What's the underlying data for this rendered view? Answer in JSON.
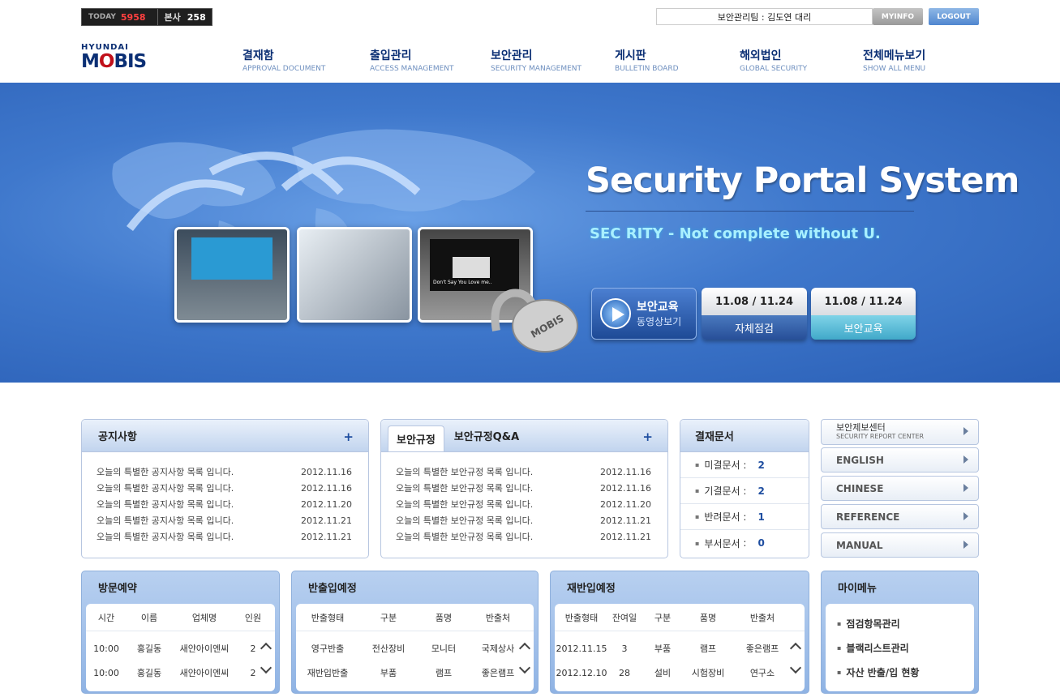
{
  "header": {
    "today_label": "TODAY",
    "today_count": "5958",
    "hq_label": "본사",
    "hq_count": "258",
    "user": "보안관리팀 : 김도연 대리",
    "myinfo": "MYINFO",
    "logout": "LOGOUT",
    "logo_small": "HYUNDAI",
    "logo_big_1": "M",
    "logo_big_2": "O",
    "logo_big_3": "BIS"
  },
  "nav": [
    {
      "ko": "결재함",
      "en": "APPROVAL DOCUMENT"
    },
    {
      "ko": "출입관리",
      "en": "ACCESS MANAGEMENT"
    },
    {
      "ko": "보안관리",
      "en": "SECURITY MANAGEMENT"
    },
    {
      "ko": "게시판",
      "en": "BULLETIN BOARD"
    },
    {
      "ko": "해외법인",
      "en": "GLOBAL SECURITY"
    },
    {
      "ko": "전체메뉴보기",
      "en": "SHOW ALL MENU"
    }
  ],
  "hero": {
    "title": "Security Portal System",
    "slogan": "SEC RITY - Not complete without U.",
    "video_1": "보안교육",
    "video_2": "동영상보기",
    "sched1_date": "11.08 / 11.24",
    "sched1_label": "자체점검",
    "sched2_date": "11.08 / 11.24",
    "sched2_label": "보안교육",
    "screen_text": "Don't Say You Love me..",
    "lock_text": "MOBIS"
  },
  "notice": {
    "title": "공지사항",
    "plus": "+",
    "rows": [
      {
        "t": "오늘의 특별한 공지사항 목록 입니다.",
        "d": "2012.11.16"
      },
      {
        "t": "오늘의 특별한 공지사항 목록 입니다.",
        "d": "2012.11.16"
      },
      {
        "t": "오늘의 특별한 공지사항 목록 입니다.",
        "d": "2012.11.20"
      },
      {
        "t": "오늘의 특별한 공지사항 목록 입니다.",
        "d": "2012.11.21"
      },
      {
        "t": "오늘의 특별한 공지사항 목록 입니다.",
        "d": "2012.11.21"
      }
    ]
  },
  "rules": {
    "tab1": "보안규정",
    "tab2": "보안규정Q&A",
    "plus": "+",
    "rows": [
      {
        "t": "오늘의 특별한 보안규정 목록 입니다.",
        "d": "2012.11.16"
      },
      {
        "t": "오늘의 특별한 보안규정 목록 입니다.",
        "d": "2012.11.16"
      },
      {
        "t": "오늘의 특별한 보안규정 목록 입니다.",
        "d": "2012.11.20"
      },
      {
        "t": "오늘의 특별한 보안규정 목록 입니다.",
        "d": "2012.11.21"
      },
      {
        "t": "오늘의 특별한 보안규정 목록 입니다.",
        "d": "2012.11.21"
      }
    ]
  },
  "approval": {
    "title": "결재문서",
    "rows": [
      {
        "l": "미결문서",
        "v": "2"
      },
      {
        "l": "기결문서",
        "v": "2"
      },
      {
        "l": "반려문서",
        "v": "1"
      },
      {
        "l": "부서문서",
        "v": "0"
      }
    ]
  },
  "side": {
    "report_ko": "보안제보센터",
    "report_en": "SECURITY REPORT CENTER",
    "english": "ENGLISH",
    "chinese": "CHINESE",
    "reference": "REFERENCE",
    "manual": "MANUAL"
  },
  "visit": {
    "title": "방문예약",
    "cols": [
      "시간",
      "이름",
      "업체명",
      "인원"
    ],
    "rows": [
      [
        "10:00",
        "홍길동",
        "새얀아이엔씨",
        "2"
      ],
      [
        "10:00",
        "홍길동",
        "새얀아이엔씨",
        "2"
      ]
    ]
  },
  "out": {
    "title": "반출입예정",
    "cols": [
      "반출형태",
      "구분",
      "품명",
      "반출처"
    ],
    "rows": [
      [
        "영구반출",
        "전산장비",
        "모니터",
        "국제상사"
      ],
      [
        "재반입반출",
        "부품",
        "램프",
        "좋은램프"
      ]
    ]
  },
  "reentry": {
    "title": "재반입예정",
    "cols": [
      "반출형태",
      "잔여일",
      "구분",
      "품명",
      "반출처"
    ],
    "rows": [
      [
        "2012.11.15",
        "3",
        "부품",
        "램프",
        "좋은램프"
      ],
      [
        "2012.12.10",
        "28",
        "설비",
        "시험장비",
        "연구소"
      ]
    ]
  },
  "mymenu": {
    "title": "마이메뉴",
    "items": [
      "점검항목관리",
      "블랙리스트관리",
      "자산 반출/입 현황"
    ]
  }
}
